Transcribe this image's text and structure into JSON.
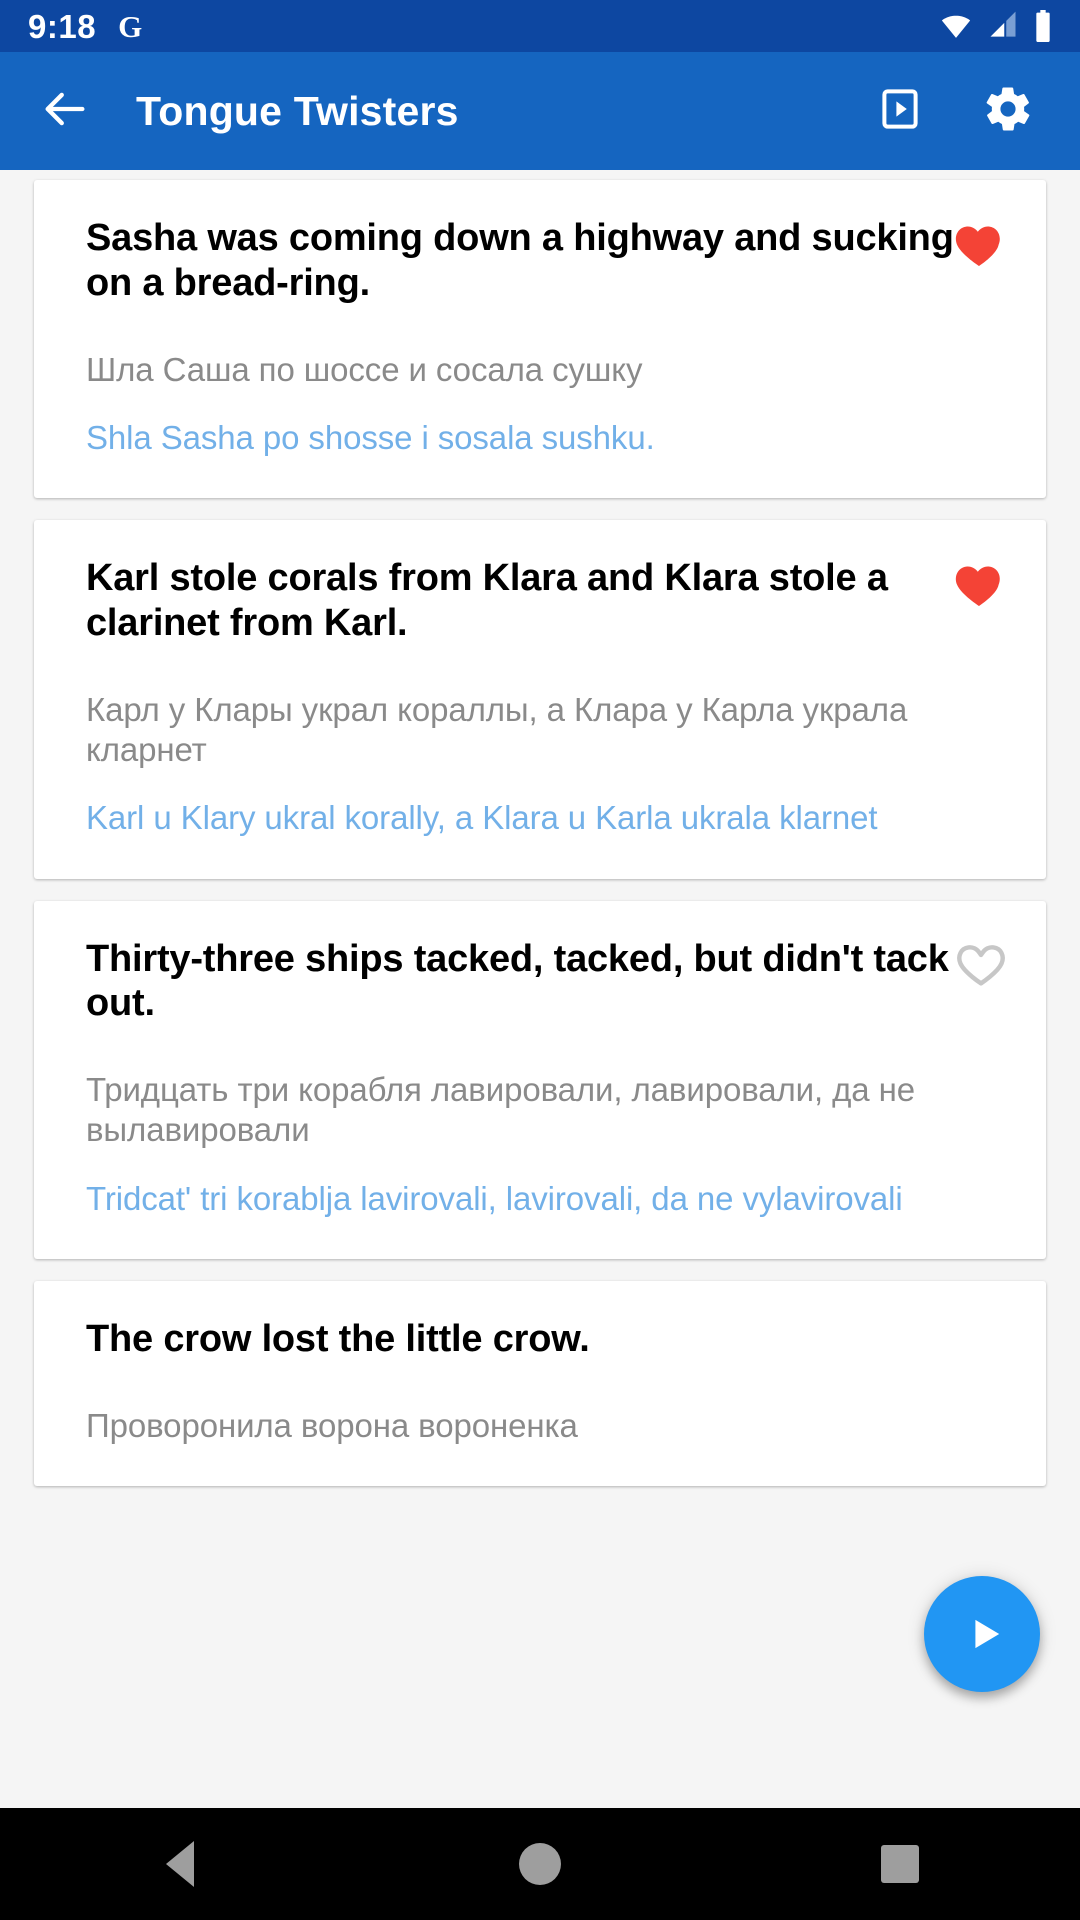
{
  "status_bar": {
    "time": "9:18",
    "assistant_glyph": "G",
    "icons": [
      "wifi-icon",
      "cellular-signal-icon",
      "battery-icon"
    ],
    "background": "#0d47a1"
  },
  "app_bar": {
    "title": "Tongue Twisters",
    "back_icon": "arrow-back-icon",
    "actions": [
      "slideshow-icon",
      "settings-gear-icon"
    ],
    "background": "#1565c0"
  },
  "colors": {
    "accent": "#1565c0",
    "favorite_filled": "#f44336",
    "favorite_empty": "#bdbdbd",
    "translit": "#72b0e8",
    "original": "#8a8a8a",
    "fab": "#2196f3"
  },
  "list": {
    "cards": [
      {
        "title": "Sasha was coming down a highway and sucking on a bread-ring.",
        "original": "Шла Саша по шоссе и сосала сушку",
        "transliteration": "Shla Sasha po shosse i sosala sushku.",
        "favorite": true
      },
      {
        "title": "Karl stole corals from Klara and Klara stole a clarinet from Karl.",
        "original": "Карл у Клары украл кораллы, а Клара у Карла украла кларнет",
        "transliteration": "Karl u Klary ukral korally, a Klara u Karla ukrala klarnet",
        "favorite": true
      },
      {
        "title": "Thirty-three ships tacked, tacked, but didn't tack out.",
        "original": "Тридцать три корабля лавировали, лавировали, да не вылавировали",
        "transliteration": "Tridcat' tri korablja lavirovali, lavirovali, da ne vylavirovali",
        "favorite": false
      },
      {
        "title": "The crow lost the little crow.",
        "original": "Проворонила ворона вороненка",
        "transliteration": "",
        "favorite": false
      }
    ]
  },
  "fab": {
    "icon": "play-icon",
    "label": "Play"
  },
  "nav_bar": {
    "buttons": [
      "back-triangle-icon",
      "home-circle-icon",
      "recents-square-icon"
    ]
  }
}
